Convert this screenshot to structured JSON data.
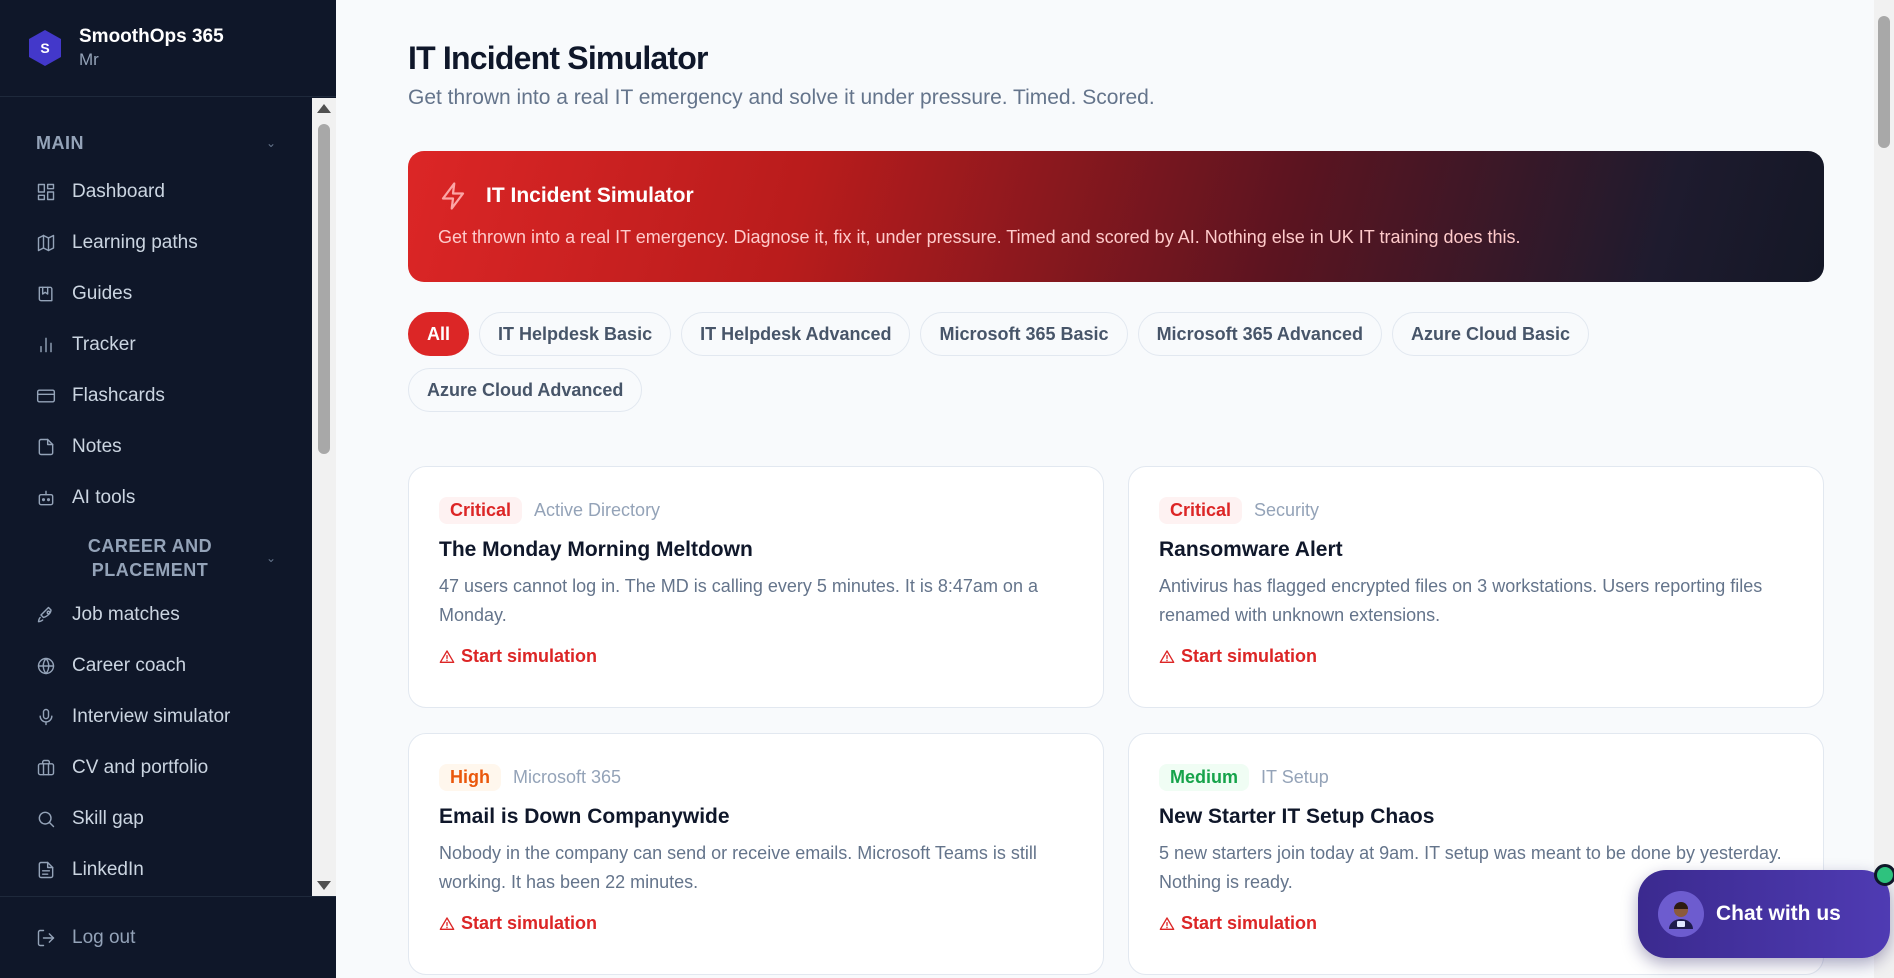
{
  "brand": {
    "name": "SmoothOps 365",
    "subtitle": "Mr",
    "logo_letter": "S"
  },
  "sidebar": {
    "sections": [
      {
        "label": "MAIN",
        "items": [
          {
            "label": "Dashboard",
            "icon": "dashboard-icon"
          },
          {
            "label": "Learning paths",
            "icon": "map-icon"
          },
          {
            "label": "Guides",
            "icon": "book-icon"
          },
          {
            "label": "Tracker",
            "icon": "bar-chart-icon"
          },
          {
            "label": "Flashcards",
            "icon": "card-icon"
          },
          {
            "label": "Notes",
            "icon": "file-icon"
          },
          {
            "label": "AI tools",
            "icon": "bot-icon"
          }
        ]
      },
      {
        "label": "CAREER AND PLACEMENT",
        "items": [
          {
            "label": "Job matches",
            "icon": "rocket-icon"
          },
          {
            "label": "Career coach",
            "icon": "globe-icon"
          },
          {
            "label": "Interview simulator",
            "icon": "mic-icon"
          },
          {
            "label": "CV and portfolio",
            "icon": "briefcase-icon"
          },
          {
            "label": "Skill gap",
            "icon": "search-icon"
          },
          {
            "label": "LinkedIn",
            "icon": "document-icon"
          }
        ]
      }
    ],
    "logout": "Log out"
  },
  "page": {
    "title": "IT Incident Simulator",
    "subtitle": "Get thrown into a real IT emergency and solve it under pressure. Timed. Scored."
  },
  "hero": {
    "title": "IT Incident Simulator",
    "description": "Get thrown into a real IT emergency. Diagnose it, fix it, under pressure. Timed and scored by AI. Nothing else in UK IT training does this."
  },
  "filters": [
    {
      "label": "All",
      "active": true
    },
    {
      "label": "IT Helpdesk Basic",
      "active": false
    },
    {
      "label": "IT Helpdesk Advanced",
      "active": false
    },
    {
      "label": "Microsoft 365 Basic",
      "active": false
    },
    {
      "label": "Microsoft 365 Advanced",
      "active": false
    },
    {
      "label": "Azure Cloud Basic",
      "active": false
    },
    {
      "label": "Azure Cloud Advanced",
      "active": false
    }
  ],
  "scenarios": [
    {
      "severity": "Critical",
      "severity_level": "critical",
      "category": "Active Directory",
      "title": "The Monday Morning Meltdown",
      "description": "47 users cannot log in. The MD is calling every 5 minutes. It is 8:47am on a Monday.",
      "action": "Start simulation"
    },
    {
      "severity": "Critical",
      "severity_level": "critical",
      "category": "Security",
      "title": "Ransomware Alert",
      "description": "Antivirus has flagged encrypted files on 3 workstations. Users reporting files renamed with unknown extensions.",
      "action": "Start simulation"
    },
    {
      "severity": "High",
      "severity_level": "high",
      "category": "Microsoft 365",
      "title": "Email is Down Companywide",
      "description": "Nobody in the company can send or receive emails. Microsoft Teams is still working. It has been 22 minutes.",
      "action": "Start simulation"
    },
    {
      "severity": "Medium",
      "severity_level": "medium",
      "category": "IT Setup",
      "title": "New Starter IT Setup Chaos",
      "description": "5 new starters join today at 9am. IT setup was meant to be done by yesterday. Nothing is ready.",
      "action": "Start simulation"
    }
  ],
  "chat": {
    "label": "Chat with us"
  },
  "colors": {
    "accent": "#dc2626",
    "sidebar_bg": "#0f1729",
    "brand_logo": "#4338ca"
  }
}
